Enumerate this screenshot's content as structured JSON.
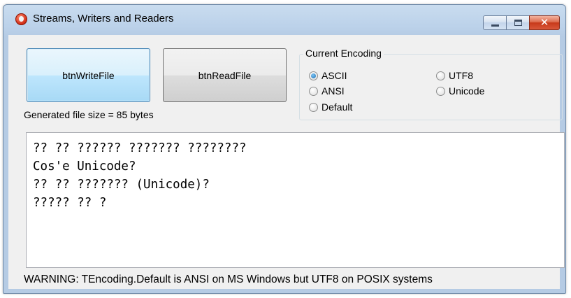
{
  "window": {
    "title": "Streams, Writers and Readers",
    "close_glyph": "✕"
  },
  "buttons": {
    "write_label": "btnWriteFile",
    "read_label": "btnReadFile"
  },
  "status": {
    "file_size_text": "Generated file size = 85 bytes"
  },
  "encoding": {
    "group_label": "Current Encoding",
    "options": [
      {
        "label": "ASCII",
        "checked": true
      },
      {
        "label": "ANSI",
        "checked": false
      },
      {
        "label": "Default",
        "checked": false
      },
      {
        "label": "UTF8",
        "checked": false
      },
      {
        "label": "Unicode",
        "checked": false
      }
    ]
  },
  "memo": {
    "lines": [
      "?? ?? ?????? ??????? ????????",
      "Cos'e Unicode?",
      "?? ?? ??????? (Unicode)?",
      "????? ?? ?"
    ]
  },
  "footer": {
    "warning": "WARNING: TEncoding.Default is ANSI on MS Windows but UTF8 on POSIX systems"
  },
  "colors": {
    "title_bar": "#bcd2ea",
    "client_bg": "#f0f0f0",
    "focus_button": "#bee6fd",
    "close_button": "#c7391a"
  }
}
